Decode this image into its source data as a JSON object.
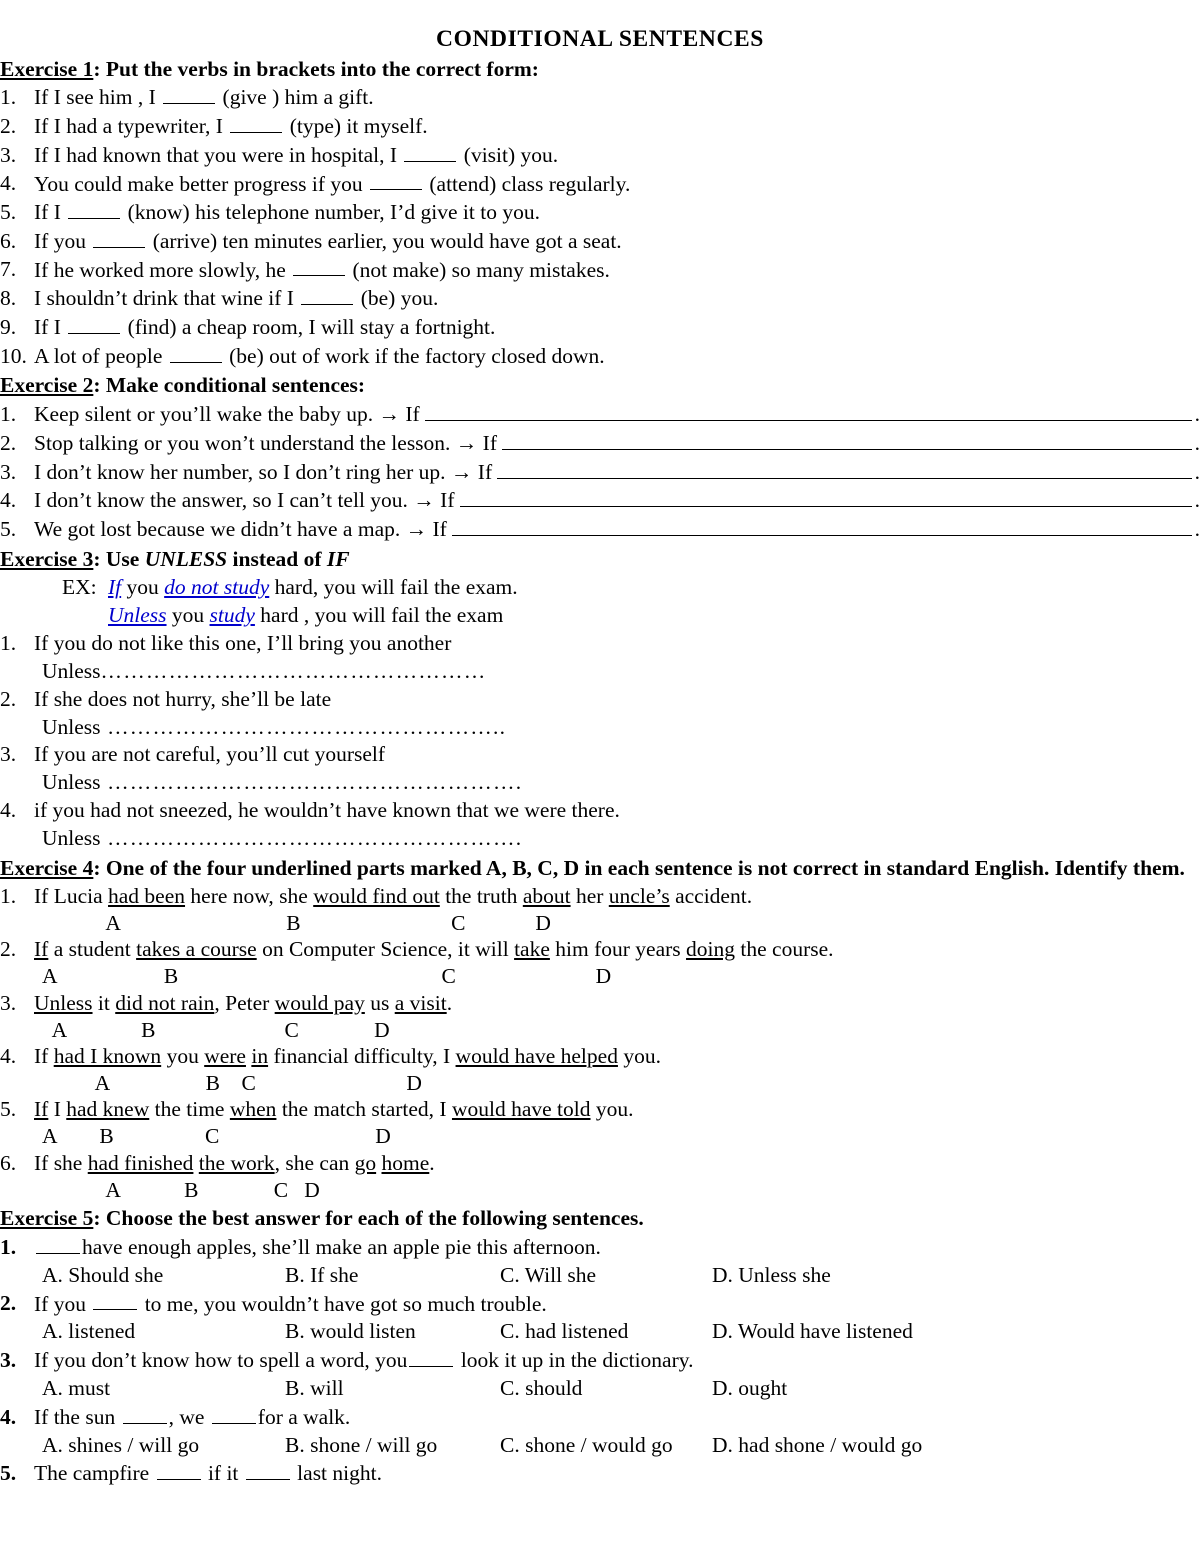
{
  "document": {
    "title": "CONDITIONAL SENTENCES"
  },
  "exercise1": {
    "heading_label": "Exercise 1",
    "heading_rest": ": Put the verbs in brackets into the correct form:",
    "items": [
      {
        "num": "1.",
        "pre": "If I see him , I ",
        "post": " (give ) him a gift."
      },
      {
        "num": "2.",
        "pre": "If I had a typewriter, I ",
        "post": " (type) it myself."
      },
      {
        "num": "3.",
        "pre": "If I had known that you were in hospital, I ",
        "post": " (visit) you."
      },
      {
        "num": "4.",
        "pre": "You could make better progress if you ",
        "post": " (attend) class regularly."
      },
      {
        "num": "5.",
        "pre": "If I ",
        "post": " (know) his telephone number, I’d give it to you."
      },
      {
        "num": "6.",
        "pre": "If you ",
        "post": " (arrive) ten minutes earlier, you would have got a seat."
      },
      {
        "num": "7.",
        "pre": "If he worked more slowly, he ",
        "post": " (not make) so many mistakes."
      },
      {
        "num": "8.",
        "pre": "I shouldn’t drink that wine if I ",
        "post": " (be) you."
      },
      {
        "num": "9.",
        "pre": "If I ",
        "post": " (find) a cheap room, I will stay a fortnight."
      },
      {
        "num": "10.",
        "pre": "A lot of people ",
        "post": " (be) out of work if the factory closed down."
      }
    ]
  },
  "exercise2": {
    "heading_label": "Exercise 2",
    "heading_rest": ": Make conditional sentences:",
    "items": [
      {
        "num": "1.",
        "text": "Keep silent or you’ll wake the baby up. → If",
        "end": "."
      },
      {
        "num": "2.",
        "text": "Stop talking or you won’t understand the lesson. → If",
        "end": "."
      },
      {
        "num": "3.",
        "text": "I don’t know her number, so I don’t ring her up. → If",
        "end": "."
      },
      {
        "num": "4.",
        "text": "I don’t know the answer, so I can’t tell you. → If",
        "end": "."
      },
      {
        "num": "5.",
        "text": "We got lost because we didn’t have a map. → If",
        "end": "."
      }
    ]
  },
  "exercise3": {
    "heading_label": "Exercise 3",
    "heading_mid": ":  Use ",
    "heading_em1": "UNLESS",
    "heading_mid2": " instead of ",
    "heading_em2": "IF",
    "example_label": "EX:",
    "example_line1": {
      "b1": "If",
      "t1": " you ",
      "b2": "do not study",
      "t2": " hard, you will fail the exam."
    },
    "example_line2": {
      "b1": "Unless",
      "t1": " you ",
      "b2": "study",
      "t2": " hard , you will fail the exam"
    },
    "items": [
      {
        "num": "1.",
        "text": "If you do not like this one, I’ll bring you another",
        "answer_label": "Unless",
        "dots": "……………………………………………"
      },
      {
        "num": "2.",
        "text": "If she does not hurry, she’ll be late",
        "answer_label": "Unless",
        "dots": " …………………………………………….."
      },
      {
        "num": "3.",
        "text": "If you are not careful, you’ll cut yourself",
        "answer_label": "Unless",
        "dots": " ………………………………………………."
      },
      {
        "num": "4.",
        "text": "if you had not sneezed, he wouldn’t have known that we were there.",
        "answer_label": "Unless",
        "dots": " ………………………………………………."
      }
    ]
  },
  "exercise4": {
    "heading_label": "Exercise 4",
    "heading_rest": ":  One of the four underlined parts marked A, B, C, D in each sentence is not correct in standard English. Identify them.",
    "items": [
      {
        "num": "1.",
        "parts": [
          {
            "t": "If Lucia ",
            "u": false
          },
          {
            "t": "had been",
            "u": true
          },
          {
            "t": " here now, she ",
            "u": false
          },
          {
            "t": "would find out",
            "u": true
          },
          {
            "t": " the truth ",
            "u": false
          },
          {
            "t": "about",
            "u": true
          },
          {
            "t": " her ",
            "u": false
          },
          {
            "t": "uncle’s",
            "u": true
          },
          {
            "t": " accident.",
            "u": false
          }
        ],
        "markers": "            A                               B                            C             D"
      },
      {
        "num": "2.",
        "parts": [
          {
            "t": "If",
            "u": true
          },
          {
            "t": " a student ",
            "u": false
          },
          {
            "t": "takes a course",
            "u": true
          },
          {
            "t": " on Computer Science, it will ",
            "u": false
          },
          {
            "t": "take",
            "u": true
          },
          {
            "t": " him four years ",
            "u": false
          },
          {
            "t": "doing",
            "u": true
          },
          {
            "t": " the course.",
            "u": false
          }
        ],
        "markers": "A                    B                                                 C                          D"
      },
      {
        "num": "3.",
        "parts": [
          {
            "t": "Unless",
            "u": true
          },
          {
            "t": " it ",
            "u": false
          },
          {
            "t": "did not rain",
            "u": true
          },
          {
            "t": ", Peter ",
            "u": false
          },
          {
            "t": "would pay",
            "u": true
          },
          {
            "t": " us ",
            "u": false
          },
          {
            "t": "a visit",
            "u": true
          },
          {
            "t": ".",
            "u": false
          }
        ],
        "markers": "  A              B                        C              D"
      },
      {
        "num": "4.",
        "parts": [
          {
            "t": "If ",
            "u": false
          },
          {
            "t": "had I known",
            "u": true
          },
          {
            "t": " you ",
            "u": false
          },
          {
            "t": "were",
            "u": true
          },
          {
            "t": " ",
            "u": false
          },
          {
            "t": "in",
            "u": true
          },
          {
            "t": " financial difficulty, I ",
            "u": false
          },
          {
            "t": "would have helped",
            "u": true
          },
          {
            "t": " you.",
            "u": false
          }
        ],
        "markers": "          A                  B    C                            D"
      },
      {
        "num": "5.",
        "parts": [
          {
            "t": "If",
            "u": true
          },
          {
            "t": " I ",
            "u": false
          },
          {
            "t": "had knew",
            "u": true
          },
          {
            "t": " the time ",
            "u": false
          },
          {
            "t": "when",
            "u": true
          },
          {
            "t": " the match started, I ",
            "u": false
          },
          {
            "t": "would have told",
            "u": true
          },
          {
            "t": " you.",
            "u": false
          }
        ],
        "markers": "A        B                 C                             D"
      },
      {
        "num": "6.",
        "parts": [
          {
            "t": "If she ",
            "u": false
          },
          {
            "t": "had finished",
            "u": true
          },
          {
            "t": " ",
            "u": false
          },
          {
            "t": "the work",
            "u": true
          },
          {
            "t": ", she can ",
            "u": false
          },
          {
            "t": "go",
            "u": true
          },
          {
            "t": " ",
            "u": false
          },
          {
            "t": "home",
            "u": true
          },
          {
            "t": ".",
            "u": false
          }
        ],
        "markers": "            A            B              C   D"
      }
    ]
  },
  "exercise5": {
    "heading_label": "Exercise 5",
    "heading_rest": ": Choose the best answer for each of the following sentences.",
    "items": [
      {
        "num": "1.",
        "pre": "",
        "mid": "have enough apples, she’ll make an apple pie this afternoon.",
        "post": "",
        "blanks": 1,
        "options": [
          "A. Should she",
          "B. If she",
          "C. Will she",
          "D. Unless she"
        ]
      },
      {
        "num": "2.",
        "pre": "If you ",
        "mid": " to me, you wouldn’t have got so much trouble.",
        "post": "",
        "blanks": 1,
        "options": [
          "A. listened",
          "B. would listen",
          "C. had listened",
          "D. Would have listened"
        ]
      },
      {
        "num": "3.",
        "pre": "If you don’t know how to spell a word, you",
        "mid": " look it up in the dictionary.",
        "post": "",
        "blanks": 1,
        "options": [
          "A. must",
          "B. will",
          "C. should",
          "D. ought"
        ]
      },
      {
        "num": "4.",
        "pre": "If the sun ",
        "mid": ", we ",
        "post": "for a walk.",
        "blanks": 2,
        "options": [
          "A. shines / will go",
          "B. shone / will go",
          "C. shone / would go",
          "D. had shone / would go"
        ]
      },
      {
        "num": "5.",
        "pre": "The campfire ",
        "mid": " if it ",
        "post": " last night.",
        "blanks": 2,
        "options": []
      }
    ]
  }
}
